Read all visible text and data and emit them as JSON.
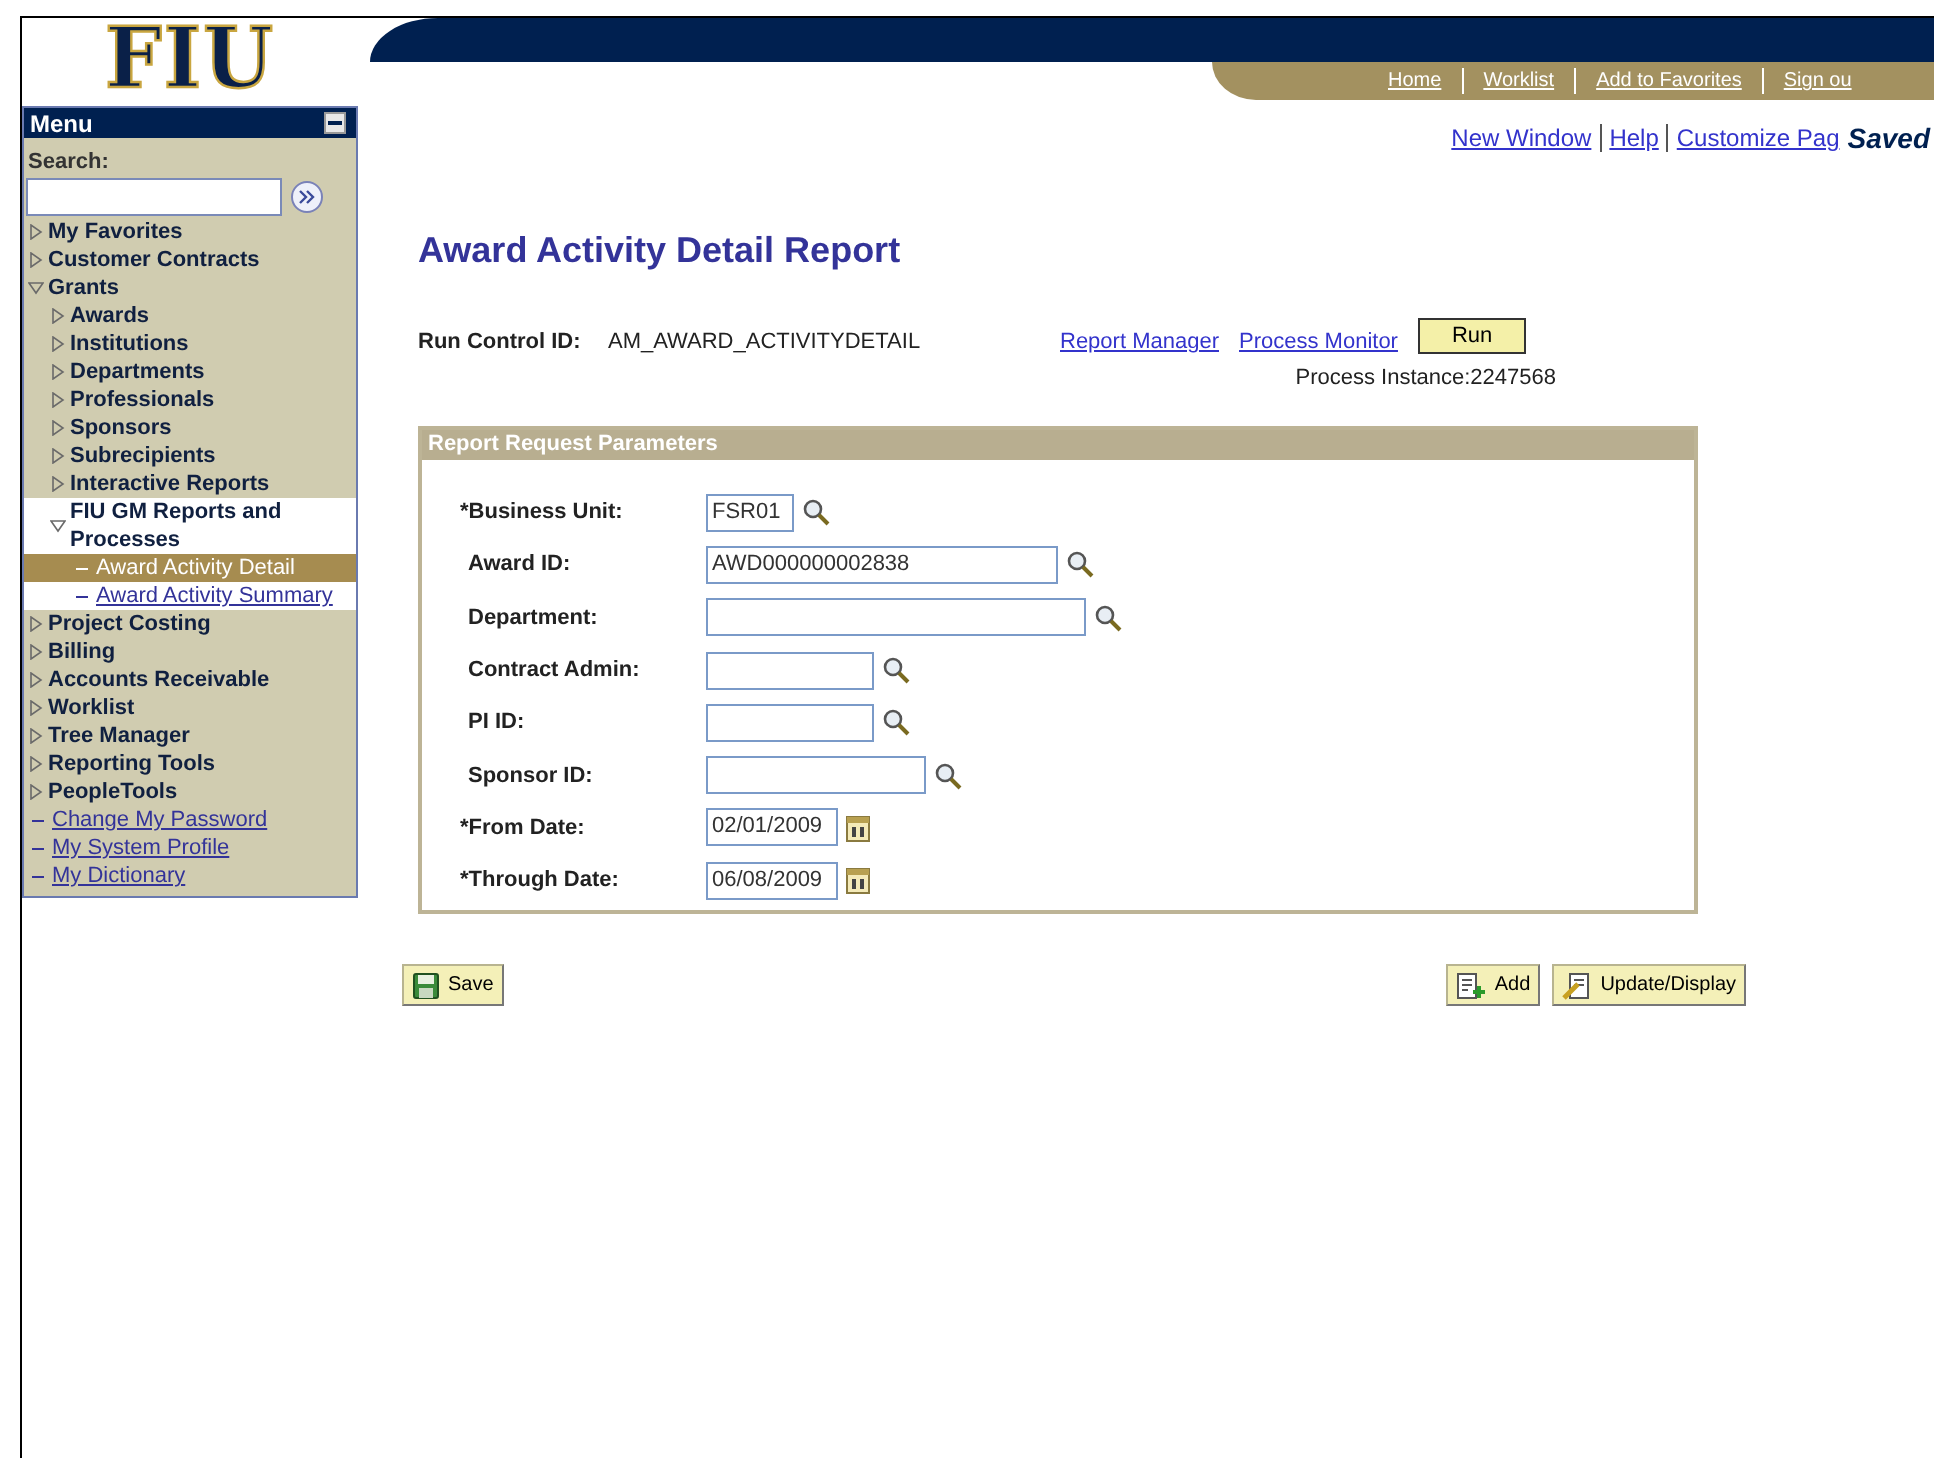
{
  "logo": {
    "text": "FIU"
  },
  "menu": {
    "title": "Menu",
    "search_label": "Search:",
    "items": [
      {
        "label": "My Favorites",
        "kind": "folder",
        "expanded": false
      },
      {
        "label": "Customer Contracts",
        "kind": "folder",
        "expanded": false
      },
      {
        "label": "Grants",
        "kind": "folder",
        "expanded": true,
        "children": [
          {
            "label": "Awards",
            "kind": "folder",
            "expanded": false
          },
          {
            "label": "Institutions",
            "kind": "folder",
            "expanded": false
          },
          {
            "label": "Departments",
            "kind": "folder",
            "expanded": false
          },
          {
            "label": "Professionals",
            "kind": "folder",
            "expanded": false
          },
          {
            "label": "Sponsors",
            "kind": "folder",
            "expanded": false
          },
          {
            "label": "Subrecipients",
            "kind": "folder",
            "expanded": false
          },
          {
            "label": "Interactive Reports",
            "kind": "folder",
            "expanded": false
          },
          {
            "label": "FIU GM Reports and Processes",
            "kind": "folder",
            "expanded": true,
            "children": [
              {
                "label": "Award Activity Detail",
                "kind": "link",
                "selected": true
              },
              {
                "label": "Award Activity Summary",
                "kind": "link",
                "selected": false
              }
            ]
          }
        ]
      },
      {
        "label": "Project Costing",
        "kind": "folder",
        "expanded": false
      },
      {
        "label": "Billing",
        "kind": "folder",
        "expanded": false
      },
      {
        "label": "Accounts Receivable",
        "kind": "folder",
        "expanded": false
      },
      {
        "label": "Worklist",
        "kind": "folder",
        "expanded": false
      },
      {
        "label": "Tree Manager",
        "kind": "folder",
        "expanded": false
      },
      {
        "label": "Reporting Tools",
        "kind": "folder",
        "expanded": false
      },
      {
        "label": "PeopleTools",
        "kind": "folder",
        "expanded": false
      },
      {
        "label": "Change My Password",
        "kind": "link",
        "selected": false
      },
      {
        "label": "My System Profile",
        "kind": "link",
        "selected": false
      },
      {
        "label": "My Dictionary",
        "kind": "link",
        "selected": false
      }
    ]
  },
  "header_links": [
    "Home",
    "Worklist",
    "Add to Favorites",
    "Sign ou"
  ],
  "page_links": [
    "New Window",
    "Help",
    "Customize Pag"
  ],
  "saved_text": "Saved",
  "page_title": "Award Activity Detail Report",
  "run_control": {
    "label": "Run Control ID:",
    "value": "AM_AWARD_ACTIVITYDETAIL",
    "links": [
      "Report Manager",
      "Process Monitor"
    ],
    "run_button": "Run",
    "process_instance": "Process Instance:2247568"
  },
  "parameters": {
    "title": "Report Request Parameters",
    "fields": [
      {
        "label": "*Business Unit:",
        "value": "FSR01",
        "kind": "lookup"
      },
      {
        "label": "Award ID:",
        "value": "AWD000000002838",
        "kind": "lookup"
      },
      {
        "label": "Department:",
        "kind": "lookup"
      },
      {
        "label": "Contract Admin:",
        "kind": "lookup"
      },
      {
        "label": "PI ID:",
        "kind": "lookup"
      },
      {
        "label": "Sponsor ID:",
        "kind": "lookup"
      },
      {
        "label": "*From Date:",
        "value": "02/01/2009",
        "kind": "date"
      },
      {
        "label": "*Through Date:",
        "value": "06/08/2009",
        "kind": "date"
      }
    ]
  },
  "buttons": {
    "save": "Save",
    "add": "Add",
    "update": "Update/Display"
  }
}
